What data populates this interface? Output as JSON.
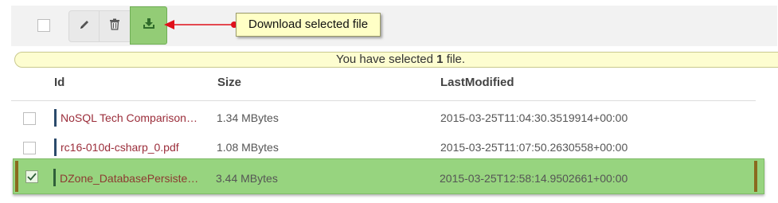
{
  "toolbar": {
    "edit_icon": "pencil-icon",
    "delete_icon": "trash-icon",
    "download_icon": "download-icon"
  },
  "callout": {
    "text": "Download selected file"
  },
  "selection_bar": {
    "prefix": "You have selected",
    "count": "1",
    "suffix": "file."
  },
  "columns": {
    "id": "Id",
    "size": "Size",
    "modified": "LastModified"
  },
  "rows": [
    {
      "id": "NoSQL Tech Comparison…",
      "size": "1.34 MBytes",
      "modified": "2015-03-25T11:04:30.3519914+00:00",
      "selected": false
    },
    {
      "id": "rc16-010d-csharp_0.pdf",
      "size": "1.08 MBytes",
      "modified": "2015-03-25T11:07:50.2630558+00:00",
      "selected": false
    },
    {
      "id": "DZone_DatabasePersiste…",
      "size": "3.44 MBytes",
      "modified": "2015-03-25T12:58:14.9502661+00:00",
      "selected": true
    }
  ],
  "colors": {
    "selected_row": "#97d47f",
    "download_button": "#93cc76",
    "callout_bg": "#ffffc6",
    "arrow": "#e0101a",
    "file_link": "#9b2d3a"
  }
}
